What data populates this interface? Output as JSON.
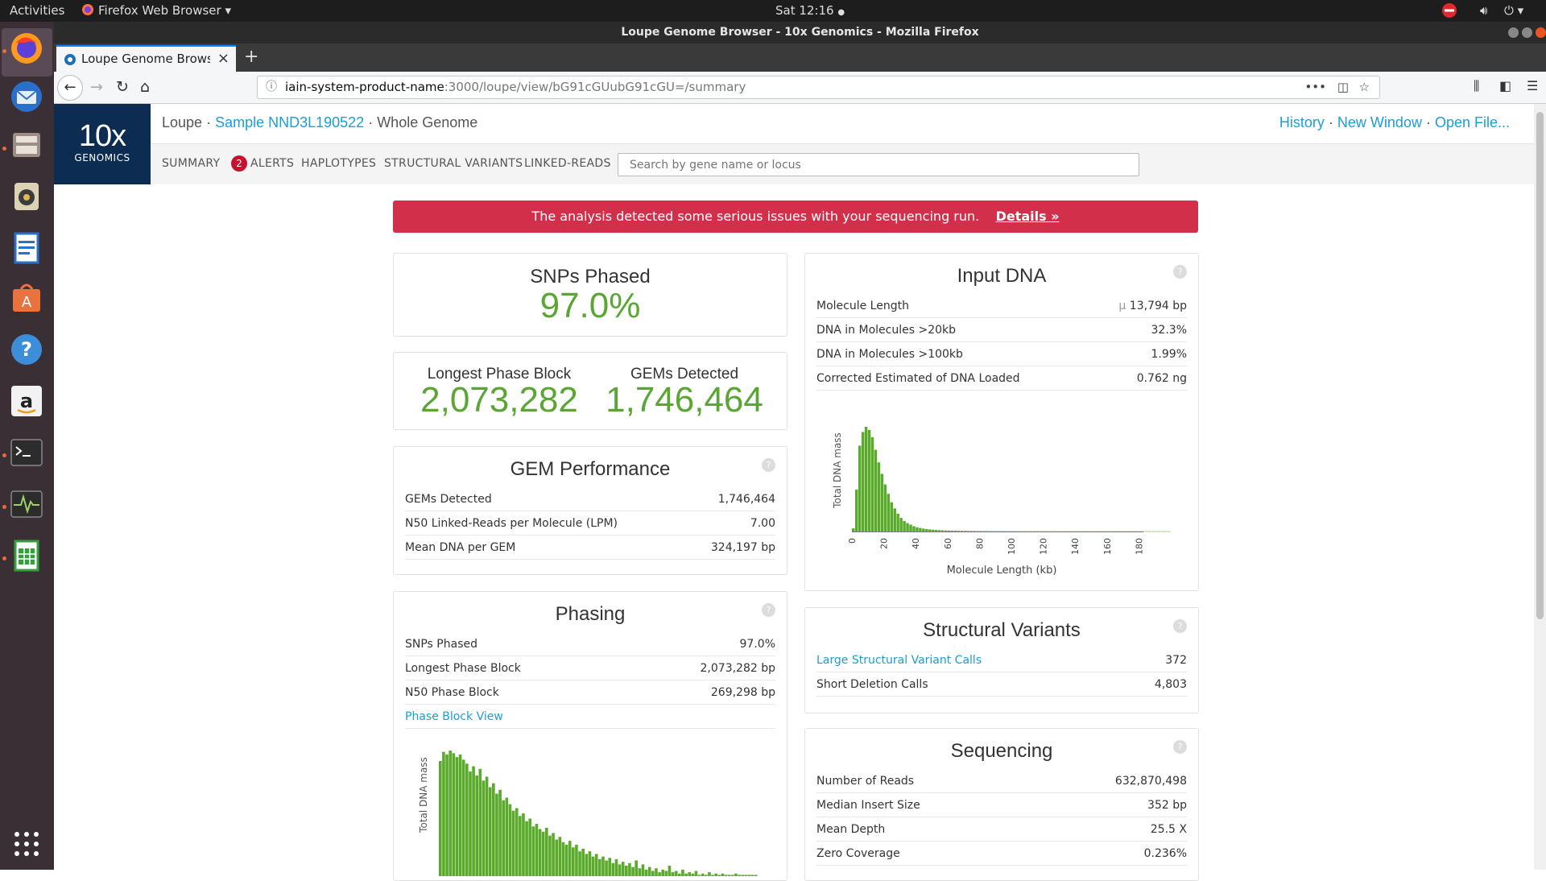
{
  "os": {
    "activities": "Activities",
    "app_menu": "Firefox Web Browser",
    "clock": "Sat 12:16",
    "status_dot": "●"
  },
  "window": {
    "title": "Loupe Genome Browser - 10x Genomics - Mozilla Firefox"
  },
  "browser": {
    "tab_title": "Loupe Genome Browser",
    "tab_close": "×",
    "new_tab": "+",
    "url_host": "iain-system-product-name",
    "url_path": ":3000/loupe/view/bG91cGUubG91cGU=/summary",
    "url_more": "•••"
  },
  "app": {
    "logo_big": "10x",
    "logo_small": "GENOMICS",
    "brand": "Loupe",
    "sep1": " · ",
    "sample": "Sample NND3L190522",
    "sep2": " · ",
    "view": "Whole Genome",
    "right_links": [
      "History",
      "New Window",
      "Open File..."
    ],
    "right_sep": " · ",
    "nav": {
      "summary": "SUMMARY",
      "alerts_count": "2",
      "alerts": "ALERTS",
      "haplotypes": "HAPLOTYPES",
      "structural_variants": "STRUCTURAL VARIANTS",
      "linked_reads": "LINKED-READS"
    },
    "search_placeholder": "Search by gene name or locus"
  },
  "alert": {
    "message": "The analysis detected some serious issues with your sequencing run.",
    "details": "Details »"
  },
  "snps_card": {
    "label": "SNPs Phased",
    "value": "97.0%"
  },
  "blocks_card": {
    "left_label": "Longest Phase Block",
    "left_value": "2,073,282",
    "right_label": "GEMs Detected",
    "right_value": "1,746,464"
  },
  "gem_perf": {
    "title": "GEM Performance",
    "help": "?",
    "rows": [
      {
        "k": "GEMs Detected",
        "v": "1,746,464"
      },
      {
        "k": "N50 Linked-Reads per Molecule (LPM)",
        "v": "7.00"
      },
      {
        "k": "Mean DNA per GEM",
        "v": "324,197 bp"
      }
    ]
  },
  "phasing": {
    "title": "Phasing",
    "help": "?",
    "rows": [
      {
        "k": "SNPs Phased",
        "v": "97.0%"
      },
      {
        "k": "Longest Phase Block",
        "v": "2,073,282 bp"
      },
      {
        "k": "N50 Phase Block",
        "v": "269,298 bp"
      }
    ],
    "link": "Phase Block View"
  },
  "input_dna": {
    "title": "Input DNA",
    "help": "?",
    "rows": [
      {
        "k": "Molecule Length",
        "mu": "μ",
        "v": "13,794 bp"
      },
      {
        "k": "DNA in Molecules >20kb",
        "v": "32.3%"
      },
      {
        "k": "DNA in Molecules >100kb",
        "v": "1.99%"
      },
      {
        "k": "Corrected Estimated of DNA Loaded",
        "v": "0.762 ng"
      }
    ]
  },
  "structural": {
    "title": "Structural Variants",
    "help": "?",
    "rows": [
      {
        "k": "Large Structural Variant Calls",
        "v": "372"
      },
      {
        "k": "Short Deletion Calls",
        "v": "4,803"
      }
    ]
  },
  "sequencing": {
    "title": "Sequencing",
    "help": "?",
    "rows": [
      {
        "k": "Number of Reads",
        "v": "632,870,498"
      },
      {
        "k": "Median Insert Size",
        "v": "352 bp"
      },
      {
        "k": "Mean Depth",
        "v": "25.5 X"
      },
      {
        "k": "Zero Coverage",
        "v": "0.236%"
      }
    ]
  },
  "chart_data": [
    {
      "type": "bar",
      "ylabel": "Total DNA mass",
      "xlabel": "Molecule Length (kb)",
      "xticks": [
        0,
        20,
        40,
        60,
        80,
        100,
        120,
        140,
        160,
        180
      ],
      "xlim": [
        0,
        200
      ],
      "bin_width": 2,
      "values": [
        3,
        40,
        82,
        95,
        100,
        97,
        90,
        78,
        66,
        55,
        45,
        36,
        28,
        22,
        17,
        13,
        10,
        8,
        6.5,
        5,
        4,
        3.4,
        2.8,
        2.3,
        2,
        1.7,
        1.5,
        1.3,
        1.1,
        1,
        0.9,
        0.8,
        0.75,
        0.7,
        0.65,
        0.6,
        0.55,
        0.5,
        0.5,
        0.45,
        0.45,
        0.4,
        0.4,
        0.38,
        0.36,
        0.35,
        0.34,
        0.33,
        0.32,
        0.31,
        0.3,
        0.3,
        0.29,
        0.28,
        0.28,
        0.27,
        0.27,
        0.26,
        0.26,
        0.25,
        0.25,
        0.24,
        0.24,
        0.23,
        0.23,
        0.22,
        0.22,
        0.22,
        0.21,
        0.21,
        0.2,
        0.2,
        0.2,
        0.2,
        0.2,
        0.2,
        0.2,
        0.2,
        0.2,
        0.2,
        0.2,
        0.2,
        0.2,
        0.2,
        0.2,
        0.2,
        0.2,
        0.2,
        0.2,
        0.2,
        0.2,
        0.2,
        0.2,
        0.2,
        0.2,
        0.2,
        0.2,
        0.2,
        0.2,
        0.2
      ]
    },
    {
      "type": "bar",
      "ylabel": "Total DNA mass",
      "values": [
        88,
        95,
        93,
        96,
        94,
        91,
        93,
        89,
        86,
        80,
        84,
        77,
        82,
        73,
        76,
        68,
        71,
        63,
        66,
        58,
        60,
        55,
        50,
        52,
        46,
        48,
        42,
        44,
        38,
        40,
        36,
        34,
        37,
        31,
        33,
        28,
        30,
        26,
        24,
        27,
        22,
        24,
        19,
        21,
        17,
        19,
        15,
        17,
        13,
        15,
        12,
        14,
        10,
        13,
        9,
        11,
        8,
        10,
        7,
        12,
        6,
        9,
        5,
        7,
        4,
        6,
        3,
        5,
        4,
        8,
        3,
        4,
        2,
        5,
        2,
        3,
        2,
        4,
        1,
        2,
        1,
        3,
        1,
        2,
        1,
        2,
        1,
        1,
        1,
        2,
        1,
        1,
        1,
        1,
        1,
        1
      ]
    }
  ]
}
